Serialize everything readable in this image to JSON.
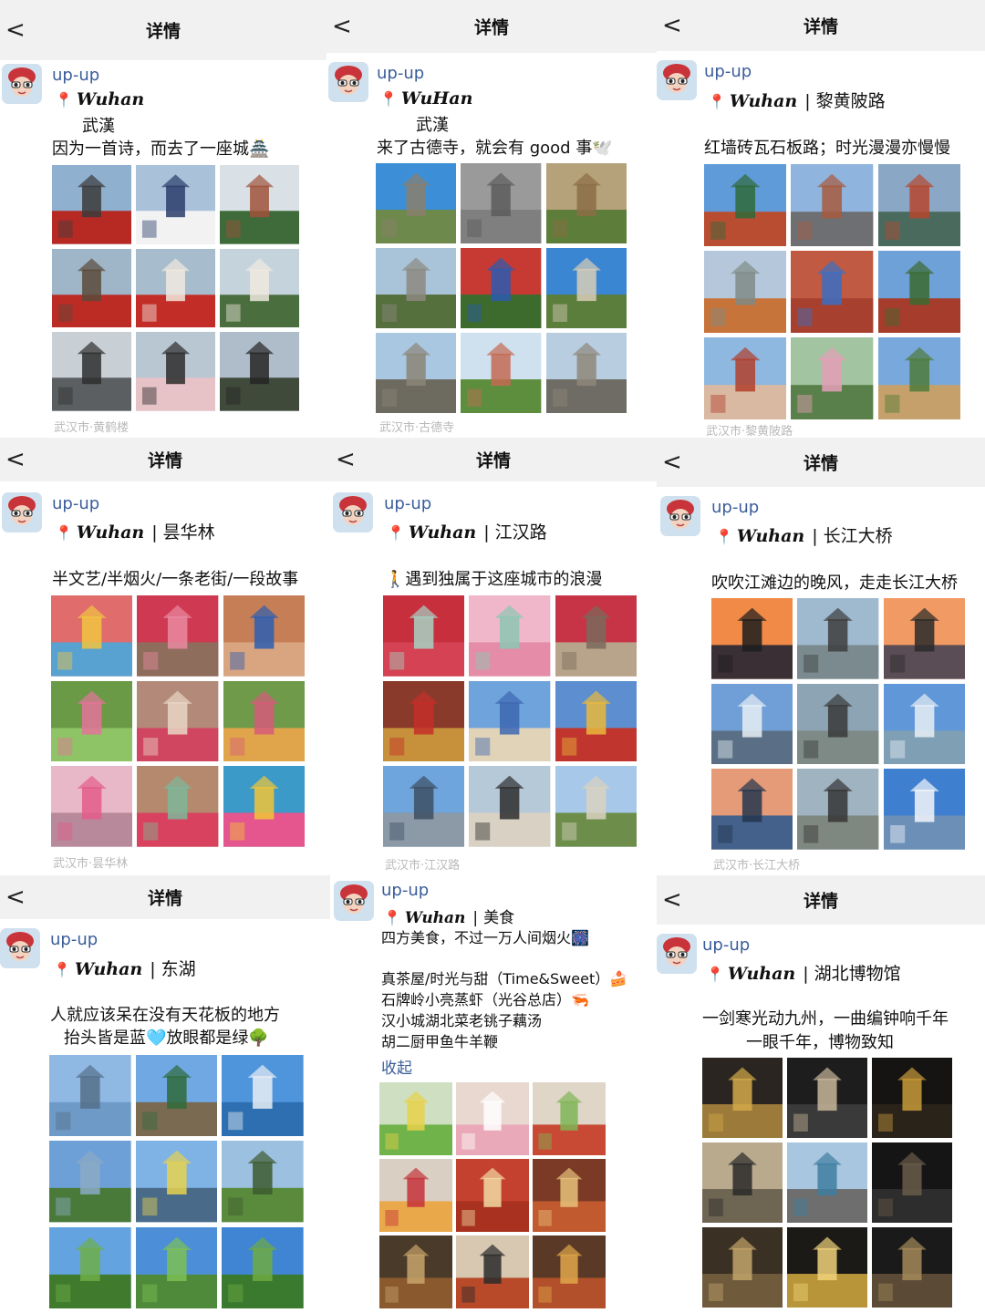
{
  "header": {
    "back_label": "<",
    "title": "详情"
  },
  "user": {
    "name": "up-up"
  },
  "colors": {
    "link": "#3a5d9a",
    "pin": "#e0352b",
    "footer": "#b9b9b9",
    "header_bg": "#f1f1f1"
  },
  "posts": [
    {
      "city": "Wuhan",
      "place": "",
      "lines": [
        "武漢",
        "因为一首诗，而去了一座城🏯"
      ],
      "footer": "武汉市·黄鹤楼",
      "tiles": [
        {
          "sky": "#8fb0cf",
          "ground": "#b72a24",
          "accent": "#3b3b3b"
        },
        {
          "sky": "#a9c2da",
          "ground": "#f2f2f2",
          "accent": "#2c3d6b"
        },
        {
          "sky": "#d9e0e6",
          "ground": "#3f6b3a",
          "accent": "#a0523a"
        },
        {
          "sky": "#9fb6c8",
          "ground": "#bd2b25",
          "accent": "#5a4a3a"
        },
        {
          "sky": "#a7bccc",
          "ground": "#c32d27",
          "accent": "#f1e9df"
        },
        {
          "sky": "#c5d3dd",
          "ground": "#4b6e3e",
          "accent": "#efe9df"
        },
        {
          "sky": "#c8cfd5",
          "ground": "#5b5f62",
          "accent": "#2e2e2e"
        },
        {
          "sky": "#b9c7d2",
          "ground": "#e7c3c8",
          "accent": "#2b2b2b"
        },
        {
          "sky": "#aebdc9",
          "ground": "#3f4a3b",
          "accent": "#252525"
        }
      ]
    },
    {
      "city": "WuHan",
      "place": "",
      "lines": [
        "武漢",
        "来了古德寺，就会有 good 事🕊️"
      ],
      "footer": "武汉市·古德寺",
      "tiles": [
        {
          "sky": "#3c8fd6",
          "ground": "#6d8a4c",
          "accent": "#8a7f6c"
        },
        {
          "sky": "#9a9a9a",
          "ground": "#7f7f7f",
          "accent": "#5c5c5c"
        },
        {
          "sky": "#b6a27a",
          "ground": "#5d7d3a",
          "accent": "#8b6d45"
        },
        {
          "sky": "#a9c3d8",
          "ground": "#556f3d",
          "accent": "#8d8a80"
        },
        {
          "sky": "#c73a33",
          "ground": "#3d6a2d",
          "accent": "#2b5bb0"
        },
        {
          "sky": "#3a86d3",
          "ground": "#5c7e3c",
          "accent": "#d8cdb7"
        },
        {
          "sky": "#a9c7e0",
          "ground": "#6d6a60",
          "accent": "#8c8577"
        },
        {
          "sky": "#cfe0ee",
          "ground": "#5d8e3e",
          "accent": "#c46a52"
        },
        {
          "sky": "#b8cde0",
          "ground": "#6e6c64",
          "accent": "#8e877a"
        }
      ]
    },
    {
      "city": "Wuhan",
      "place": "黎黄陂路",
      "lines": [
        "红墙砖瓦石板路；时光漫漫亦慢慢"
      ],
      "footer": "武汉市·黎黄陂路",
      "tiles": [
        {
          "sky": "#5f9bd9",
          "ground": "#b94d32",
          "accent": "#2f6a3a"
        },
        {
          "sky": "#8fb5de",
          "ground": "#6e6f73",
          "accent": "#a85a3e"
        },
        {
          "sky": "#8aa8c6",
          "ground": "#4a6a5e",
          "accent": "#b6472e"
        },
        {
          "sky": "#b5c8db",
          "ground": "#c7743a",
          "accent": "#7f8b86"
        },
        {
          "sky": "#c05a42",
          "ground": "#a7402e",
          "accent": "#3a6fc4"
        },
        {
          "sky": "#6ea1d8",
          "ground": "#a63c2c",
          "accent": "#3b6a2f"
        },
        {
          "sky": "#8fb8e0",
          "ground": "#d9b9a1",
          "accent": "#b13f2c"
        },
        {
          "sky": "#a3c4a0",
          "ground": "#59804a",
          "accent": "#e59fb9"
        },
        {
          "sky": "#78a8dc",
          "ground": "#c5a06a",
          "accent": "#4e7b3a"
        }
      ]
    },
    {
      "city": "Wuhan",
      "place": "昙华林",
      "lines": [
        "半文艺/半烟火/一条老街/一段故事"
      ],
      "footer": "武汉市·昙华林",
      "tiles": [
        {
          "sky": "#e06c6c",
          "ground": "#58a2d2",
          "accent": "#f0c441"
        },
        {
          "sky": "#cf3a52",
          "ground": "#8e6d5c",
          "accent": "#e98aa1"
        },
        {
          "sky": "#c67e56",
          "ground": "#d9a580",
          "accent": "#2d5eb1"
        },
        {
          "sky": "#6a9a46",
          "ground": "#8ec366",
          "accent": "#e5739a"
        },
        {
          "sky": "#b3897a",
          "ground": "#d04661",
          "accent": "#e9d6c4"
        },
        {
          "sky": "#6e9a4a",
          "ground": "#e0a54a",
          "accent": "#d65a7a"
        },
        {
          "sky": "#e9b8c8",
          "ground": "#b8899a",
          "accent": "#e35c8a"
        },
        {
          "sky": "#b4896e",
          "ground": "#d8425e",
          "accent": "#7fb79a"
        },
        {
          "sky": "#3c9ac9",
          "ground": "#e6568e",
          "accent": "#f0c437"
        }
      ]
    },
    {
      "city": "Wuhan",
      "place": "江汉路",
      "lines": [
        "🚶遇到独属于这座城市的浪漫"
      ],
      "footer": "武汉市·江汉路",
      "tiles": [
        {
          "sky": "#c82f3d",
          "ground": "#d44253",
          "accent": "#a7d2c4"
        },
        {
          "sky": "#f0b7ca",
          "ground": "#e48ca8",
          "accent": "#8cc7b4"
        },
        {
          "sky": "#c73446",
          "ground": "#b8a48a",
          "accent": "#7a6a5a"
        },
        {
          "sky": "#8a3a2a",
          "ground": "#c6913a",
          "accent": "#c42f2a"
        },
        {
          "sky": "#6fa3dc",
          "ground": "#e0d3b8",
          "accent": "#3d67b1"
        },
        {
          "sky": "#5d8fd0",
          "ground": "#c0362e",
          "accent": "#e9b93b"
        },
        {
          "sky": "#6ea5dd",
          "ground": "#8b9aa6",
          "accent": "#3d4f63"
        },
        {
          "sky": "#b6c9d9",
          "ground": "#d9d2c4",
          "accent": "#2e2e2e"
        },
        {
          "sky": "#a7c8e8",
          "ground": "#6c8e4a",
          "accent": "#d9d2c1"
        }
      ]
    },
    {
      "city": "Wuhan",
      "place": "长江大桥",
      "lines": [
        "吹吹江滩边的晚风，走走长江大桥"
      ],
      "footer": "武汉市·长江大桥",
      "tiles": [
        {
          "sky": "#f08a46",
          "ground": "#3a2f35",
          "accent": "#1d1d1d"
        },
        {
          "sky": "#9fb9cf",
          "ground": "#7a8a8f",
          "accent": "#3d3d3d"
        },
        {
          "sky": "#f29a63",
          "ground": "#5a4d55",
          "accent": "#2a2a2a"
        },
        {
          "sky": "#6f9fd6",
          "ground": "#5a6f86",
          "accent": "#e7eef5"
        },
        {
          "sky": "#8ca4b4",
          "ground": "#7d8a86",
          "accent": "#3a3a3a"
        },
        {
          "sky": "#5f97d8",
          "ground": "#7f9fb4",
          "accent": "#e8eff5"
        },
        {
          "sky": "#e59a78",
          "ground": "#43618a",
          "accent": "#24364d"
        },
        {
          "sky": "#9fb3c1",
          "ground": "#7e8880",
          "accent": "#353535"
        },
        {
          "sky": "#3f7fd0",
          "ground": "#6c8fb8",
          "accent": "#f3f6fa"
        }
      ]
    },
    {
      "city": "Wuhan",
      "place": "东湖",
      "lines": [
        "人就应该呆在没有天花板的地方",
        "抬头皆是蓝🩵放眼都是绿🌳"
      ],
      "footer": "",
      "tiles": [
        {
          "sky": "#8fb8e3",
          "ground": "#6d9ac6",
          "accent": "#55708a"
        },
        {
          "sky": "#6fa8e3",
          "ground": "#7a6a52",
          "accent": "#2f6a3a"
        },
        {
          "sky": "#4f95dc",
          "ground": "#2d6fb0",
          "accent": "#e9eef4"
        },
        {
          "sky": "#6ea0d8",
          "ground": "#4a7a3a",
          "accent": "#8aaac4"
        },
        {
          "sky": "#7fb3e6",
          "ground": "#4a6a8a",
          "accent": "#e6d24e"
        },
        {
          "sky": "#9cc0e0",
          "ground": "#5a8a3c",
          "accent": "#3d5b2f"
        },
        {
          "sky": "#62a3e0",
          "ground": "#3f7a2d",
          "accent": "#6fae48"
        },
        {
          "sky": "#4c8fd8",
          "ground": "#4f8a3a",
          "accent": "#7cbf55"
        },
        {
          "sky": "#3f85d4",
          "ground": "#3a7a2f",
          "accent": "#6faa42"
        }
      ]
    },
    {
      "city": "Wuhan",
      "place": "湖北博物馆",
      "lines": [
        "一剑寒光动九州，一曲编钟响千年",
        "一眼千年，博物致知"
      ],
      "footer": "",
      "tiles": [
        {
          "sky": "#2a2520",
          "ground": "#9c7a3a",
          "accent": "#d4a94a"
        },
        {
          "sky": "#1d1d1d",
          "ground": "#3a3a3a",
          "accent": "#c8b69a"
        },
        {
          "sky": "#161412",
          "ground": "#2a231a",
          "accent": "#c89a3a"
        },
        {
          "sky": "#b9aa8e",
          "ground": "#6f6553",
          "accent": "#2a2a2a"
        },
        {
          "sky": "#a9c6e0",
          "ground": "#6e6e6e",
          "accent": "#3e7ea0"
        },
        {
          "sky": "#151515",
          "ground": "#2d2d2d",
          "accent": "#6a5c4a"
        },
        {
          "sky": "#3a3024",
          "ground": "#6f5a3c",
          "accent": "#c2a46a"
        },
        {
          "sky": "#1c1a17",
          "ground": "#b9953a",
          "accent": "#f0d27a"
        },
        {
          "sky": "#1a1a1a",
          "ground": "#5a4a36",
          "accent": "#a58a5a"
        }
      ]
    }
  ],
  "food_post": {
    "city": "Wuhan",
    "place": "美食",
    "lines": [
      "四方美食，不过一万人间烟火🎆",
      "",
      "真茶屋/时光与甜（Time&Sweet）🍰",
      "石牌岭小亮蒸虾（光谷总店）🦐",
      "汉小城湖北菜老铫子藕汤",
      "胡二厨甲鱼牛羊鞭"
    ],
    "collapse_label": "收起",
    "tiles": [
      {
        "sky": "#cfe0c2",
        "ground": "#6fb34a",
        "accent": "#e7d14a"
      },
      {
        "sky": "#e8d8d0",
        "ground": "#e9a9b9",
        "accent": "#ffffff"
      },
      {
        "sky": "#dfd6c8",
        "ground": "#c94a34",
        "accent": "#7fb556"
      },
      {
        "sky": "#d9cfc2",
        "ground": "#e9a84a",
        "accent": "#c5333a"
      },
      {
        "sky": "#c5412f",
        "ground": "#a8321f",
        "accent": "#f1d9a2"
      },
      {
        "sky": "#7a3a26",
        "ground": "#c15a2e",
        "accent": "#e6c27a"
      },
      {
        "sky": "#4a3a2a",
        "ground": "#8a5a2e",
        "accent": "#c7a46a"
      },
      {
        "sky": "#d8c8b2",
        "ground": "#b84a2a",
        "accent": "#2a2a2a"
      },
      {
        "sky": "#5a3a26",
        "ground": "#b1502a",
        "accent": "#e0a74a"
      }
    ]
  }
}
